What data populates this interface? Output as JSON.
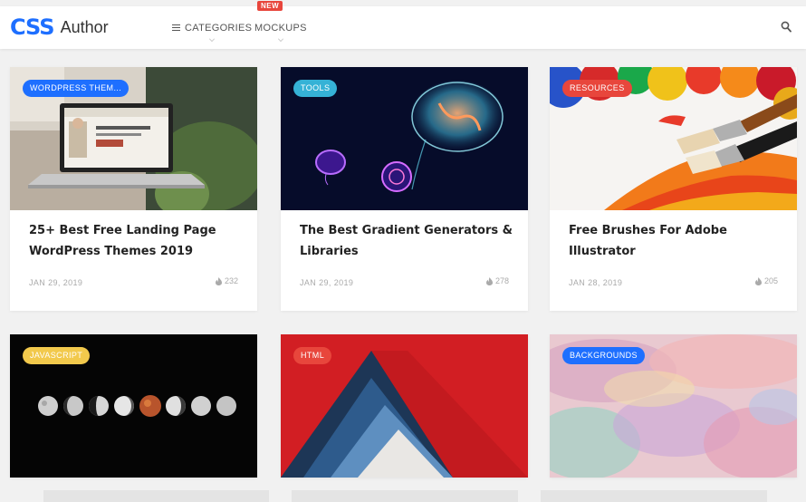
{
  "brand": {
    "mark": "CSS",
    "name": "Author",
    "mark_color": "#1e6fff"
  },
  "nav": {
    "categories_label": "CATEGORIES",
    "mockups_label": "MOCKUPS",
    "new_badge": "NEW",
    "categories_icon": "hamburger-icon",
    "search_icon": "search-icon"
  },
  "cards": [
    {
      "tag": "WORDPRESS THEM...",
      "tag_color": "#1e6fff",
      "title": "25+ Best Free Landing Page WordPress Themes 2019",
      "date": "JAN 29, 2019",
      "count": "232"
    },
    {
      "tag": "TOOLS",
      "tag_color": "#35b2d6",
      "title": "The Best Gradient Generators & Libraries",
      "date": "JAN 29, 2019",
      "count": "278"
    },
    {
      "tag": "RESOURCES",
      "tag_color": "#e8463c",
      "title": "Free Brushes For Adobe Illustrator",
      "date": "JAN 28, 2019",
      "count": "205"
    },
    {
      "tag": "JAVASCRIPT",
      "tag_color": "#f2c94c"
    },
    {
      "tag": "HTML",
      "tag_color": "#e8463c"
    },
    {
      "tag": "BACKGROUNDS",
      "tag_color": "#1e6fff"
    }
  ]
}
